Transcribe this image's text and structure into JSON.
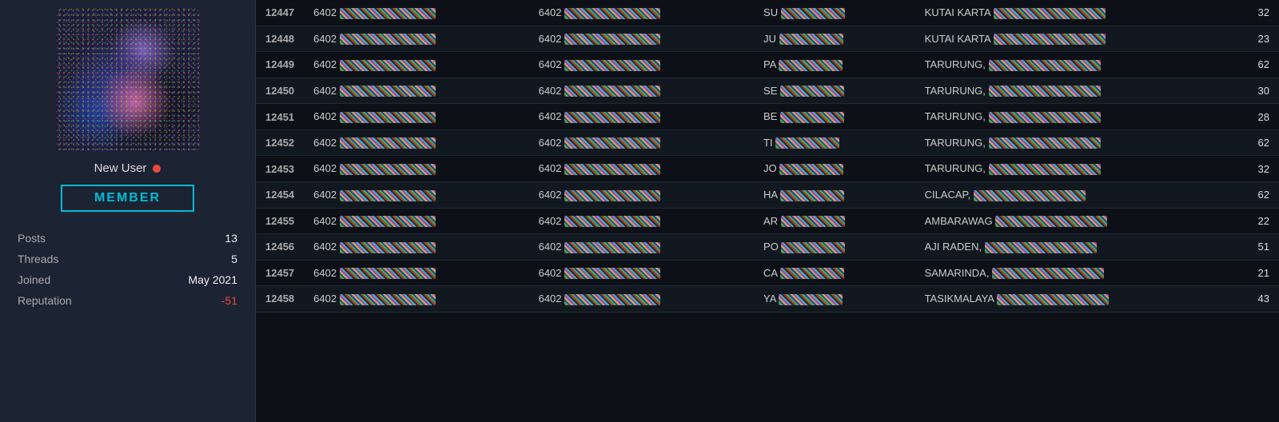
{
  "sidebar": {
    "username": "New User",
    "online": true,
    "badge": "MEMBER",
    "stats": {
      "posts_label": "Posts",
      "posts_value": "13",
      "threads_label": "Threads",
      "threads_value": "5",
      "joined_label": "Joined",
      "joined_value": "May 2021",
      "reputation_label": "Reputation",
      "reputation_value": "-51"
    }
  },
  "table": {
    "rows": [
      {
        "id": "12447",
        "col1": "6402",
        "col2": "6402",
        "col3_prefix": "SU",
        "col4_prefix": "KUTAI KARTA",
        "num": "32"
      },
      {
        "id": "12448",
        "col1": "6402",
        "col2": "6402",
        "col3_prefix": "JU",
        "col4_prefix": "KUTAI KARTA",
        "num": "23"
      },
      {
        "id": "12449",
        "col1": "6402",
        "col2": "6402",
        "col3_prefix": "PA",
        "col4_prefix": "TARURUNG, ",
        "num": "62"
      },
      {
        "id": "12450",
        "col1": "6402",
        "col2": "6402",
        "col3_prefix": "SE",
        "col4_prefix": "TARURUNG, ",
        "num": "30"
      },
      {
        "id": "12451",
        "col1": "6402",
        "col2": "6402",
        "col3_prefix": "BE",
        "col4_prefix": "TARURUNG, ",
        "num": "28"
      },
      {
        "id": "12452",
        "col1": "6402",
        "col2": "6402",
        "col3_prefix": "TI",
        "col4_prefix": "TARURUNG, ",
        "num": "62"
      },
      {
        "id": "12453",
        "col1": "6402",
        "col2": "6402",
        "col3_prefix": "JO",
        "col4_prefix": "TARURUNG, ",
        "num": "32"
      },
      {
        "id": "12454",
        "col1": "6402",
        "col2": "6402",
        "col3_prefix": "HA",
        "col4_prefix": "CILACAP, ",
        "num": "62"
      },
      {
        "id": "12455",
        "col1": "6402",
        "col2": "6402",
        "col3_prefix": "AR",
        "col4_prefix": "AMBARAWAG",
        "num": "22"
      },
      {
        "id": "12456",
        "col1": "6402",
        "col2": "6402",
        "col3_prefix": "PO",
        "col4_prefix": "AJI RADEN, ",
        "num": "51"
      },
      {
        "id": "12457",
        "col1": "6402",
        "col2": "6402",
        "col3_prefix": "CA",
        "col4_prefix": "SAMARINDA, ",
        "num": "21"
      },
      {
        "id": "12458",
        "col1": "6402",
        "col2": "6402",
        "col3_prefix": "YA",
        "col4_prefix": "TASIKMALAYA",
        "num": "43"
      }
    ]
  }
}
